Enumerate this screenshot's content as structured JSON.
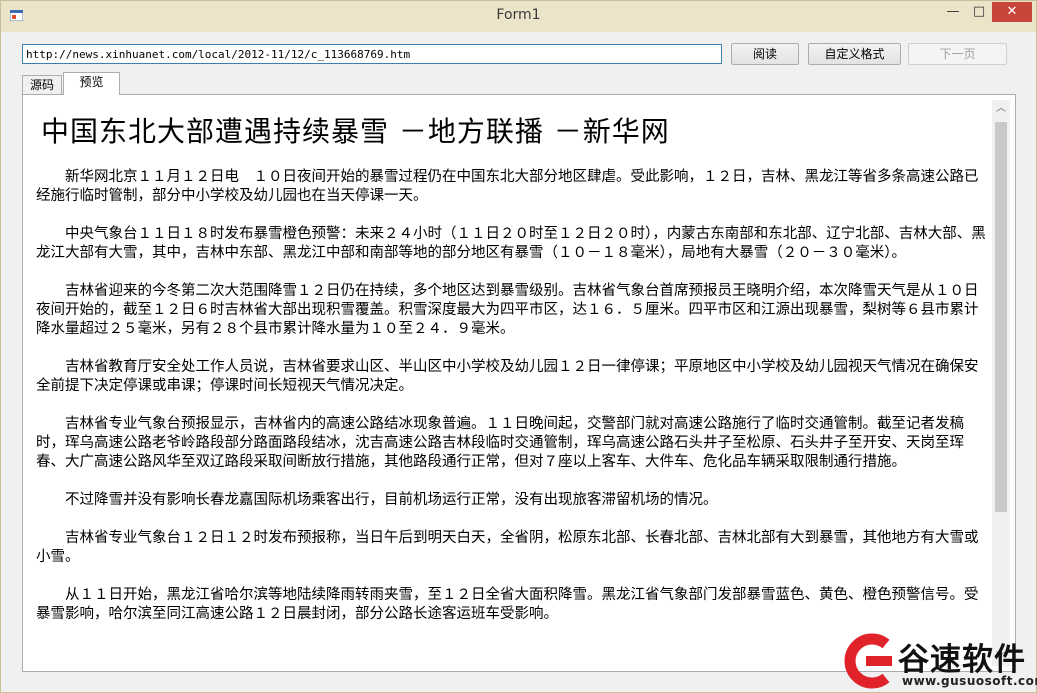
{
  "window": {
    "title": "Form1",
    "controls": {
      "minimize": "—",
      "maximize": "□",
      "close": "✕"
    }
  },
  "toolbar": {
    "url_value": "http://news.xinhuanet.com/local/2012-11/12/c_113668769.htm",
    "read_label": "阅读",
    "custom_format_label": "自定义格式",
    "next_page_label": "下一页"
  },
  "tabs": [
    {
      "label": "源码",
      "active": false
    },
    {
      "label": "预览",
      "active": true
    }
  ],
  "article": {
    "title": "中国东北大部遭遇持续暴雪 －地方联播 －新华网",
    "paragraphs": [
      "新华网北京１１月１２日电　１０日夜间开始的暴雪过程仍在中国东北大部分地区肆虐。受此影响，１２日，吉林、黑龙江等省多条高速公路已经施行临时管制，部分中小学校及幼儿园也在当天停课一天。",
      "中央气象台１１日１８时发布暴雪橙色预警：未来２４小时（１１日２０时至１２日２０时），内蒙古东南部和东北部、辽宁北部、吉林大部、黑龙江大部有大雪，其中，吉林中东部、黑龙江中部和南部等地的部分地区有暴雪（１０－１８毫米），局地有大暴雪（２０－３０毫米）。",
      "吉林省迎来的今冬第二次大范围降雪１２日仍在持续，多个地区达到暴雪级别。吉林省气象台首席预报员王晓明介绍，本次降雪天气是从１０日夜间开始的，截至１２日６时吉林省大部出现积雪覆盖。积雪深度最大为四平市区，达１６．５厘米。四平市区和江源出现暴雪，梨树等６县市累计降水量超过２５毫米，另有２８个县市累计降水量为１０至２４．９毫米。",
      "吉林省教育厅安全处工作人员说，吉林省要求山区、半山区中小学校及幼儿园１２日一律停课；平原地区中小学校及幼儿园视天气情况在确保安全前提下决定停课或串课；停课时间长短视天气情况决定。",
      "吉林省专业气象台预报显示，吉林省内的高速公路结冰现象普遍。１１日晚间起，交警部门就对高速公路施行了临时交通管制。截至记者发稿时，珲乌高速公路老爷岭路段部分路面路段结冰，沈吉高速公路吉林段临时交通管制，珲乌高速公路石头井子至松原、石头井子至开安、天岗至珲春、大广高速公路风华至双辽路段采取间断放行措施，其他路段通行正常，但对７座以上客车、大件车、危化品车辆采取限制通行措施。",
      "不过降雪并没有影响长春龙嘉国际机场乘客出行，目前机场运行正常，没有出现旅客滞留机场的情况。",
      "吉林省专业气象台１２日１２时发布预报称，当日午后到明天白天，全省阴，松原东北部、长春北部、吉林北部有大到暴雪，其他地方有大雪或小雪。",
      "从１１日开始，黑龙江省哈尔滨等地陆续降雨转雨夹雪，至１２日全省大面积降雪。黑龙江省气象部门发部暴雪蓝色、黄色、橙色预警信号。受暴雪影响，哈尔滨至同江高速公路１２日晨封闭，部分公路长途客运班车受影响。"
    ]
  },
  "scrollbar": {
    "up_glyph": "︿",
    "down_glyph": "﹀"
  },
  "watermark": {
    "name": "谷速软件",
    "url": "www.gusuosoft.com",
    "brand_color": "#e0232a"
  }
}
